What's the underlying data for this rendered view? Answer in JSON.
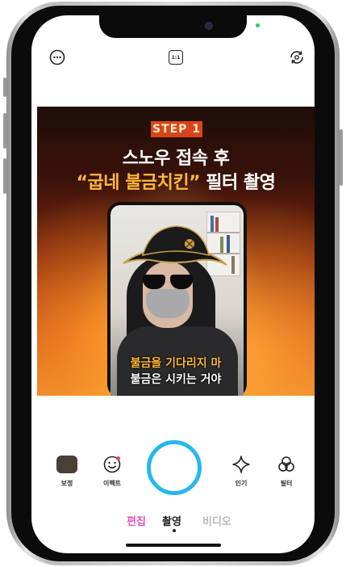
{
  "colors": {
    "accent": "#27b7ee",
    "edit_mode": "#d957b5",
    "inactive_mode": "#b9b9b9",
    "highlight_text": "#ffb838",
    "step_badge": "#d9451a"
  },
  "topbar": {
    "menu_icon": "more-circle-icon",
    "ratio_label": "1:1",
    "switch_camera_icon": "camera-switch-icon"
  },
  "preview": {
    "step": "STEP 1",
    "headline_line1": "스노우 접속 후",
    "headline_line2_highlight": "“굽네 불금치킨”",
    "headline_line2_rest": " 필터 촬영",
    "caption_line1": "불금을 기다리지 마",
    "caption_line2": "불금은 시키는 거야"
  },
  "controls": {
    "beauty_label": "보정",
    "effect_label": "이펙트",
    "popular_label": "인기",
    "filter_label": "필터"
  },
  "modes": {
    "edit": "편집",
    "shoot": "촬영",
    "video": "비디오",
    "active": "촬영"
  }
}
